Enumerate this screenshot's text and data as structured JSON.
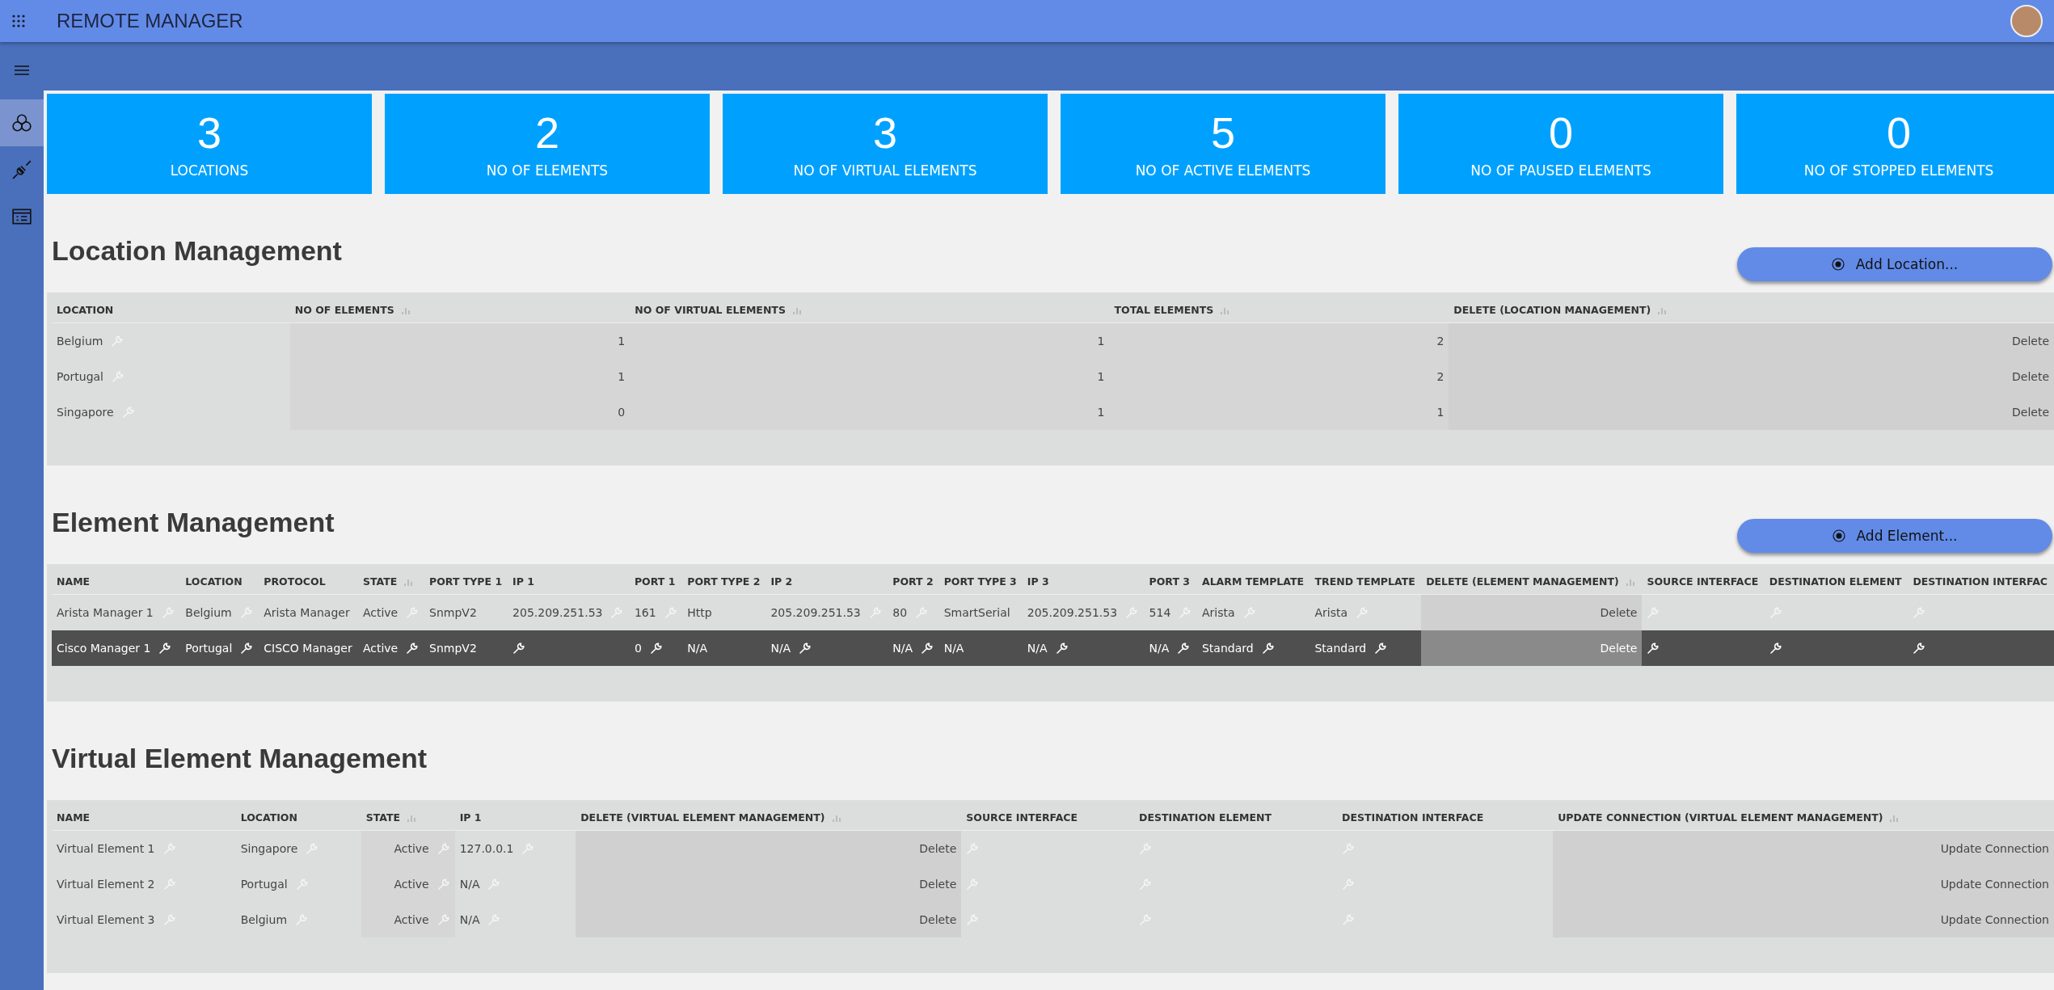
{
  "app_bar": {
    "title": "REMOTE MANAGER"
  },
  "sidebar": {
    "items": [
      {
        "selected": true
      },
      {
        "selected": false
      },
      {
        "selected": false
      }
    ]
  },
  "stats": [
    {
      "value": "3",
      "label": "LOCATIONS"
    },
    {
      "value": "2",
      "label": "NO OF ELEMENTS"
    },
    {
      "value": "3",
      "label": "NO OF VIRTUAL ELEMENTS"
    },
    {
      "value": "5",
      "label": "NO OF ACTIVE ELEMENTS"
    },
    {
      "value": "0",
      "label": "NO OF PAUSED ELEMENTS"
    },
    {
      "value": "0",
      "label": "NO OF STOPPED ELEMENTS"
    }
  ],
  "sections": [
    {
      "title": "Location Management",
      "button": "Add Location...",
      "table": {
        "columns": [
          {
            "label": "LOCATION",
            "sortable": false,
            "kind": "text"
          },
          {
            "label": "NO OF ELEMENTS",
            "sortable": true,
            "kind": "number"
          },
          {
            "label": "NO OF VIRTUAL ELEMENTS",
            "sortable": true,
            "kind": "number"
          },
          {
            "label": "TOTAL ELEMENTS",
            "sortable": true,
            "kind": "number"
          },
          {
            "label": "DELETE (LOCATION MANAGEMENT)",
            "sortable": true,
            "kind": "action"
          }
        ],
        "rows": [
          {
            "selected": false,
            "cells": [
              {
                "text": "Belgium",
                "edit": true
              },
              {
                "text": "1",
                "edit": false
              },
              {
                "text": "1",
                "edit": false
              },
              {
                "text": "2",
                "edit": false
              },
              {
                "text": "Delete",
                "edit": false
              }
            ]
          },
          {
            "selected": false,
            "cells": [
              {
                "text": "Portugal",
                "edit": true
              },
              {
                "text": "1",
                "edit": false
              },
              {
                "text": "1",
                "edit": false
              },
              {
                "text": "2",
                "edit": false
              },
              {
                "text": "Delete",
                "edit": false
              }
            ]
          },
          {
            "selected": false,
            "cells": [
              {
                "text": "Singapore",
                "edit": true
              },
              {
                "text": "0",
                "edit": false
              },
              {
                "text": "1",
                "edit": false
              },
              {
                "text": "1",
                "edit": false
              },
              {
                "text": "Delete",
                "edit": false
              }
            ]
          }
        ]
      }
    },
    {
      "title": "Element Management",
      "button": "Add Element...",
      "table": {
        "columns": [
          {
            "label": "NAME",
            "sortable": false,
            "kind": "text"
          },
          {
            "label": "LOCATION",
            "sortable": false,
            "kind": "text"
          },
          {
            "label": "PROTOCOL",
            "sortable": false,
            "kind": "text"
          },
          {
            "label": "STATE",
            "sortable": true,
            "kind": "text"
          },
          {
            "label": "PORT TYPE 1",
            "sortable": false,
            "kind": "text"
          },
          {
            "label": "IP 1",
            "sortable": false,
            "kind": "text"
          },
          {
            "label": "PORT 1",
            "sortable": false,
            "kind": "text"
          },
          {
            "label": "PORT TYPE 2",
            "sortable": false,
            "kind": "text"
          },
          {
            "label": "IP 2",
            "sortable": false,
            "kind": "text"
          },
          {
            "label": "PORT 2",
            "sortable": false,
            "kind": "text"
          },
          {
            "label": "PORT TYPE 3",
            "sortable": false,
            "kind": "text"
          },
          {
            "label": "IP 3",
            "sortable": false,
            "kind": "text"
          },
          {
            "label": "PORT 3",
            "sortable": false,
            "kind": "text"
          },
          {
            "label": "ALARM TEMPLATE",
            "sortable": false,
            "kind": "text"
          },
          {
            "label": "TREND TEMPLATE",
            "sortable": false,
            "kind": "text"
          },
          {
            "label": "DELETE (ELEMENT MANAGEMENT)",
            "sortable": true,
            "kind": "action"
          },
          {
            "label": "SOURCE INTERFACE",
            "sortable": false,
            "kind": "text"
          },
          {
            "label": "DESTINATION ELEMENT",
            "sortable": false,
            "kind": "text"
          },
          {
            "label": "DESTINATION INTERFAC",
            "sortable": false,
            "kind": "text"
          }
        ],
        "rows": [
          {
            "selected": false,
            "cells": [
              {
                "text": "Arista Manager 1",
                "edit": true
              },
              {
                "text": "Belgium",
                "edit": true
              },
              {
                "text": "Arista Manager",
                "edit": false
              },
              {
                "text": "Active",
                "edit": true
              },
              {
                "text": "SnmpV2",
                "edit": false
              },
              {
                "text": "205.209.251.53",
                "edit": true
              },
              {
                "text": "161",
                "edit": true
              },
              {
                "text": "Http",
                "edit": false
              },
              {
                "text": "205.209.251.53",
                "edit": true
              },
              {
                "text": "80",
                "edit": true
              },
              {
                "text": "SmartSerial",
                "edit": false
              },
              {
                "text": "205.209.251.53",
                "edit": true
              },
              {
                "text": "514",
                "edit": true
              },
              {
                "text": "Arista",
                "edit": true
              },
              {
                "text": "Arista",
                "edit": true
              },
              {
                "text": "Delete",
                "edit": false
              },
              {
                "edit": true
              },
              {
                "edit": true
              },
              {
                "edit": true
              }
            ]
          },
          {
            "selected": true,
            "cells": [
              {
                "text": "Cisco Manager 1",
                "edit": true
              },
              {
                "text": "Portugal",
                "edit": true
              },
              {
                "text": "CISCO Manager",
                "edit": false
              },
              {
                "text": "Active",
                "edit": true
              },
              {
                "text": "SnmpV2",
                "edit": false
              },
              {
                "edit": true
              },
              {
                "text": "0",
                "edit": true
              },
              {
                "text": "N/A",
                "edit": false
              },
              {
                "text": "N/A",
                "edit": true
              },
              {
                "text": "N/A",
                "edit": true
              },
              {
                "text": "N/A",
                "edit": false
              },
              {
                "text": "N/A",
                "edit": true
              },
              {
                "text": "N/A",
                "edit": true
              },
              {
                "text": "Standard",
                "edit": true
              },
              {
                "text": "Standard",
                "edit": true
              },
              {
                "text": "Delete",
                "edit": false
              },
              {
                "edit": true
              },
              {
                "edit": true
              },
              {
                "edit": true
              }
            ]
          }
        ]
      }
    },
    {
      "title": "Virtual Element Management",
      "table": {
        "columns": [
          {
            "label": "NAME",
            "sortable": false,
            "kind": "text"
          },
          {
            "label": "LOCATION",
            "sortable": false,
            "kind": "text"
          },
          {
            "label": "STATE",
            "sortable": true,
            "kind": "number"
          },
          {
            "label": "IP 1",
            "sortable": false,
            "kind": "text"
          },
          {
            "label": "DELETE (VIRTUAL ELEMENT MANAGEMENT)",
            "sortable": true,
            "kind": "action"
          },
          {
            "label": "SOURCE INTERFACE",
            "sortable": false,
            "kind": "text"
          },
          {
            "label": "DESTINATION ELEMENT",
            "sortable": false,
            "kind": "text"
          },
          {
            "label": "DESTINATION INTERFACE",
            "sortable": false,
            "kind": "text"
          },
          {
            "label": "UPDATE CONNECTION (VIRTUAL ELEMENT MANAGEMENT)",
            "sortable": true,
            "kind": "action"
          }
        ],
        "rows": [
          {
            "selected": false,
            "cells": [
              {
                "text": "Virtual Element 1",
                "edit": true
              },
              {
                "text": "Singapore",
                "edit": true
              },
              {
                "text": "Active",
                "edit": true
              },
              {
                "text": "127.0.0.1",
                "edit": true
              },
              {
                "text": "Delete",
                "edit": false
              },
              {
                "edit": true
              },
              {
                "edit": true
              },
              {
                "edit": true
              },
              {
                "text": "Update Connection",
                "edit": false
              }
            ]
          },
          {
            "selected": false,
            "cells": [
              {
                "text": "Virtual Element 2",
                "edit": true
              },
              {
                "text": "Portugal",
                "edit": true
              },
              {
                "text": "Active",
                "edit": true
              },
              {
                "text": "N/A",
                "edit": true
              },
              {
                "text": "Delete",
                "edit": false
              },
              {
                "edit": true
              },
              {
                "edit": true
              },
              {
                "edit": true
              },
              {
                "text": "Update Connection",
                "edit": false
              }
            ]
          },
          {
            "selected": false,
            "cells": [
              {
                "text": "Virtual Element 3",
                "edit": true
              },
              {
                "text": "Belgium",
                "edit": true
              },
              {
                "text": "Active",
                "edit": true
              },
              {
                "text": "N/A",
                "edit": true
              },
              {
                "text": "Delete",
                "edit": false
              },
              {
                "edit": true
              },
              {
                "edit": true
              },
              {
                "edit": true
              },
              {
                "text": "Update Connection",
                "edit": false
              }
            ]
          }
        ]
      }
    }
  ]
}
